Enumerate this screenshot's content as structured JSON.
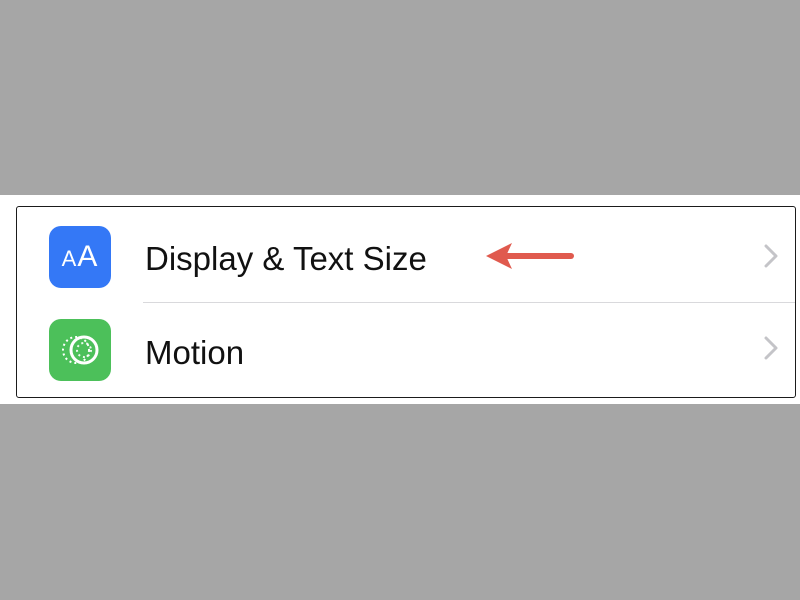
{
  "settings": {
    "rows": [
      {
        "label": "Display & Text Size",
        "icon": "text-size-icon",
        "icon_text_small": "A",
        "icon_text_big": "A",
        "icon_color": "#3478f6"
      },
      {
        "label": "Motion",
        "icon": "motion-icon",
        "icon_color": "#4cc05a"
      }
    ]
  },
  "annotation": {
    "arrow_color": "#e05a4e",
    "icon": "left-arrow-icon"
  },
  "colors": {
    "background_band": "#a6a6a6",
    "panel": "#ffffff",
    "chevron": "#c4c4c8"
  }
}
